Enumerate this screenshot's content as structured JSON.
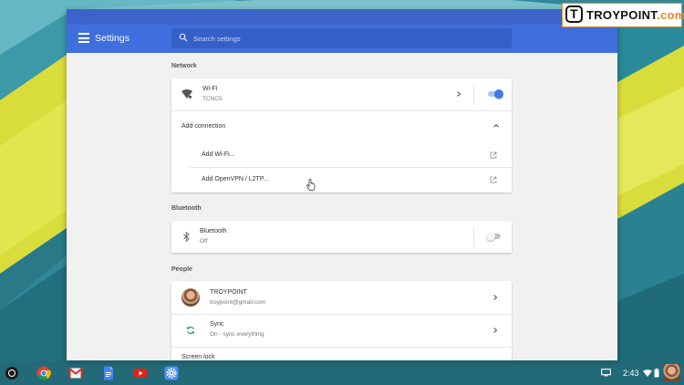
{
  "window": {
    "title": "Settings",
    "search_placeholder": "Search settings"
  },
  "sections": {
    "network": {
      "title": "Network",
      "wifi_label": "Wi-Fi",
      "wifi_network": "TCNC5",
      "wifi_enabled": true,
      "add_connection_label": "Add connection",
      "add_wifi_label": "Add Wi-Fi...",
      "add_vpn_label": "Add OpenVPN / L2TP..."
    },
    "bluetooth": {
      "title": "Bluetooth",
      "label": "Bluetooth",
      "status": "Off",
      "enabled": false
    },
    "people": {
      "title": "People",
      "account_name": "TROYPOINT",
      "account_email": "troypoint@gmail.com",
      "sync_label": "Sync",
      "sync_status": "On - sync everything",
      "screen_lock_label": "Screen lock"
    }
  },
  "shelf": {
    "apps": [
      "launcher-icon",
      "chrome-icon",
      "gmail-icon",
      "docs-icon",
      "youtube-icon",
      "settings-icon"
    ],
    "clock": "2:43",
    "tray_icons": [
      "display-icon",
      "wifi-icon",
      "battery-icon",
      "avatar"
    ]
  },
  "logo": {
    "text_main": "TROYPOINT",
    "text_suffix": ".com"
  },
  "colors": {
    "appbar": "#3f6fdd",
    "accent_blue": "#3f7be8",
    "wallpaper_teal": "#2f8898",
    "wallpaper_yellow": "#d9dd3b",
    "logo_orange": "#e08a2a"
  }
}
